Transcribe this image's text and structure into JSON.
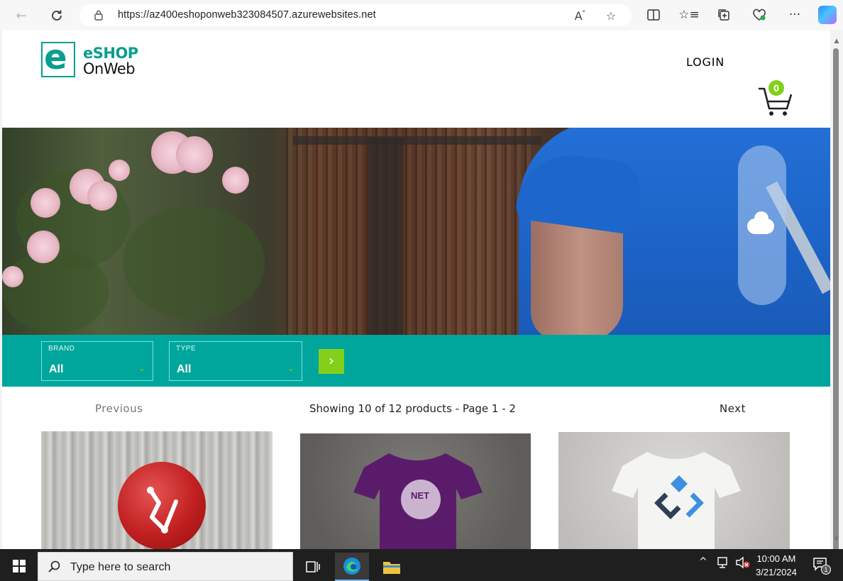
{
  "browser": {
    "url": "https://az400eshoponweb323084507.azurewebsites.net"
  },
  "header": {
    "logo_top": "eSHOP",
    "logo_bottom": "OnWeb",
    "logo_letter": "e",
    "login_label": "LOGIN",
    "cart_count": "0"
  },
  "filters": {
    "brand": {
      "label": "BRAND",
      "value": "All"
    },
    "type": {
      "label": "TYPE",
      "value": "All"
    },
    "go_label": "›"
  },
  "pager": {
    "previous": "Previous",
    "info": "Showing 10 of 12 products - Page 1 - 2",
    "next": "Next"
  },
  "products": [
    {
      "image": "red-mug-photo"
    },
    {
      "image": "purple-dotnet-tshirt-photo",
      "print_text": "NET"
    },
    {
      "image": "white-tshirt-photo"
    }
  ],
  "taskbar": {
    "search_placeholder": "Type here to search",
    "time": "10:00 AM",
    "date": "3/21/2024",
    "notification_count": "1"
  },
  "colors": {
    "brand_teal": "#00a69c",
    "accent_green": "#83d01b",
    "logo_teal": "#0a9e8e"
  }
}
